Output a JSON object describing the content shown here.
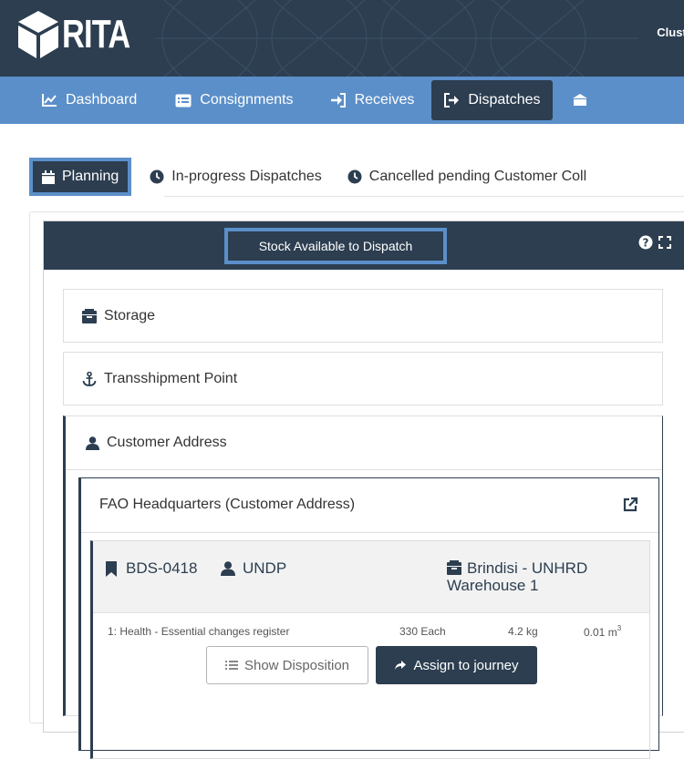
{
  "app": {
    "logo_text": "RITA",
    "cluster_text": "Cluste"
  },
  "nav": {
    "items": [
      {
        "label": "Dashboard",
        "icon": "chart-line-icon",
        "active": false
      },
      {
        "label": "Consignments",
        "icon": "list-icon",
        "active": false
      },
      {
        "label": "Receives",
        "icon": "sign-in-icon",
        "active": false
      },
      {
        "label": "Dispatches",
        "icon": "sign-out-icon",
        "active": true
      }
    ]
  },
  "tabs": [
    {
      "label": "Planning",
      "icon": "calendar-icon",
      "active": true
    },
    {
      "label": "In-progress Dispatches",
      "icon": "clock-icon",
      "active": false
    },
    {
      "label": "Cancelled pending Customer Coll",
      "icon": "clock-icon",
      "active": false
    }
  ],
  "panel": {
    "title": "Stock Available to Dispatch",
    "sections": {
      "storage": "Storage",
      "transshipment": "Transshipment Point",
      "customer": "Customer Address"
    },
    "customer_group": {
      "name": "FAO Headquarters (Customer Address)",
      "item": {
        "id": "BDS-0418",
        "org": "UNDP",
        "warehouse": "Brindisi - UNHRD Warehouse 1",
        "line": {
          "description": "1: Health - Essential changes register",
          "quantity": "330 Each",
          "weight": "4.2 kg",
          "volume": "0.01 m",
          "volume_exp": "3"
        },
        "show_disposition": "Show Disposition",
        "assign_journey": "Assign to journey"
      }
    }
  },
  "colors": {
    "header": "#2c3e50",
    "nav": "#5b8fc9",
    "highlight": "#5b8fc9"
  }
}
